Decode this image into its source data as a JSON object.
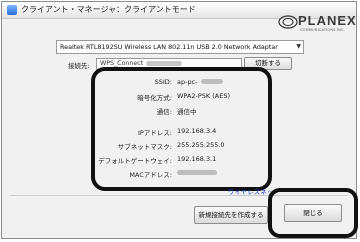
{
  "window": {
    "title": "クライアント・マネージャ：クライアントモード"
  },
  "brand": {
    "name": "PLANEX",
    "tagline": "COMMUNICATIONS INC."
  },
  "adapter": {
    "selected": "Realtek RTL8192SU Wireless LAN 802.11n USB 2.0 Network Adaptar"
  },
  "connection": {
    "label": "接続先:",
    "selected": "WPS_Connect",
    "disconnect_label": "切断する"
  },
  "details": [
    {
      "label": "SSID:",
      "value": "ap-pc-"
    },
    {
      "label": "暗号化方式:",
      "value": "WPA2-PSK (AES)"
    },
    {
      "label": "通信:",
      "value": "通信中"
    },
    {
      "label": "IPアドレス:",
      "value": "192.168.3.4"
    },
    {
      "label": "サブネットマスク:",
      "value": "255.255.255.0"
    },
    {
      "label": "デフォルトゲートウェイ:",
      "value": "192.168.3.1"
    },
    {
      "label": "MACアドレス:",
      "value": ""
    }
  ],
  "links": {
    "wireless": "ワイヤレスネッ"
  },
  "buttons": {
    "new_connection": "新規接続先を作成する",
    "close": "閉じる"
  }
}
